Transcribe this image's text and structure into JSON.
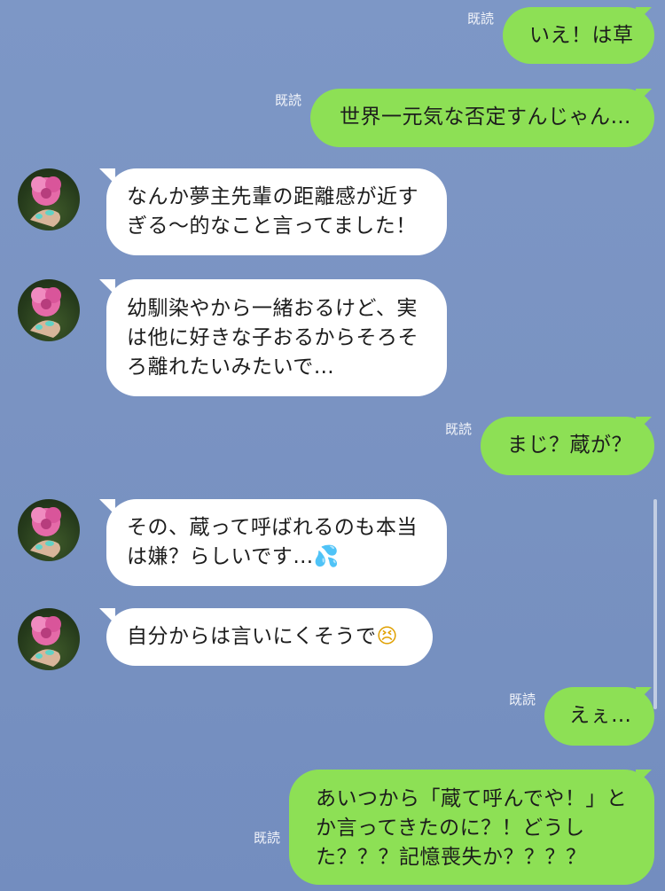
{
  "read_label": "既読",
  "messages": [
    {
      "dir": "out",
      "text": "いえ！は草"
    },
    {
      "dir": "out",
      "text": "世界一元気な否定すんじゃん…"
    },
    {
      "dir": "in",
      "text": "なんか夢主先輩の距離感が近す\nぎる〜的なこと言ってました！"
    },
    {
      "dir": "in",
      "text": "幼馴染やから一緒おるけど、実\nは他に好きな子おるからそろそ\nろ離れたいみたいで…"
    },
    {
      "dir": "out",
      "text": "まじ？蔵が？"
    },
    {
      "dir": "in",
      "text": "その、蔵って呼ばれるのも本当\nは嫌？らしいです…",
      "emoji": "💦"
    },
    {
      "dir": "in",
      "text": "自分からは言いにくそうで",
      "emoji": "😣"
    },
    {
      "dir": "out",
      "text": "えぇ…"
    },
    {
      "dir": "out",
      "text": "あいつから「蔵て呼んでや！」と\nか言ってきたのに？！どうし\nた？？？記憶喪失か？？？？"
    }
  ],
  "colors": {
    "background": "#7a93c2",
    "outgoing_bubble": "#8de055",
    "incoming_bubble": "#ffffff",
    "read_text": "#f3f5fa"
  },
  "icons": {
    "avatar": "flower-avatar-icon"
  }
}
